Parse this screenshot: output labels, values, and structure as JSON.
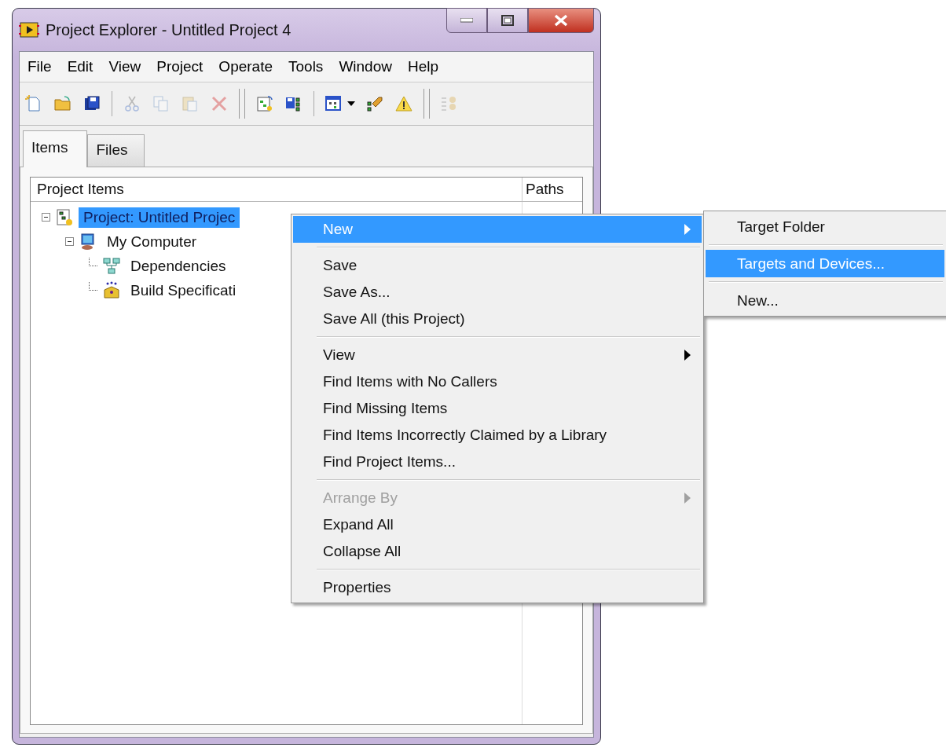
{
  "window": {
    "title": "Project Explorer - Untitled Project 4"
  },
  "menu_bar": [
    "File",
    "Edit",
    "View",
    "Project",
    "Operate",
    "Tools",
    "Window",
    "Help"
  ],
  "toolbar": [
    {
      "kind": "new",
      "disabled": false
    },
    {
      "kind": "open",
      "disabled": false
    },
    {
      "kind": "save",
      "disabled": false
    },
    {
      "kind": "separator"
    },
    {
      "kind": "cut",
      "disabled": true
    },
    {
      "kind": "copy",
      "disabled": true
    },
    {
      "kind": "paste",
      "disabled": true
    },
    {
      "kind": "delete",
      "disabled": true
    },
    {
      "kind": "grip"
    },
    {
      "kind": "add-file",
      "disabled": false
    },
    {
      "kind": "save-project",
      "disabled": false
    },
    {
      "kind": "separator"
    },
    {
      "kind": "view",
      "disabled": false
    },
    {
      "kind": "dropdown",
      "disabled": false
    },
    {
      "kind": "arrow-item",
      "disabled": false
    },
    {
      "kind": "warning",
      "disabled": false
    },
    {
      "kind": "grip"
    },
    {
      "kind": "build",
      "disabled": true
    }
  ],
  "tabs": [
    {
      "label": "Items",
      "selected": true
    },
    {
      "label": "Files",
      "selected": false
    }
  ],
  "tree": {
    "columns": [
      "Project Items",
      "Paths"
    ],
    "items": [
      {
        "label": "Project: Untitled Projec",
        "kind": "project",
        "selected": true,
        "expanded": true,
        "children": [
          {
            "label": "My Computer",
            "kind": "computer",
            "selected": false,
            "expanded": true,
            "children": [
              {
                "label": "Dependencies",
                "kind": "dependencies",
                "selected": false
              },
              {
                "label": "Build Specificati",
                "kind": "build",
                "selected": false
              }
            ]
          }
        ]
      }
    ]
  },
  "context_menu": {
    "items": [
      {
        "kind": "item",
        "label": "New",
        "selected": true,
        "disabled": false,
        "submenu": true
      },
      {
        "kind": "separator"
      },
      {
        "kind": "item",
        "label": "Save",
        "selected": false,
        "disabled": false,
        "submenu": false
      },
      {
        "kind": "item",
        "label": "Save As...",
        "selected": false,
        "disabled": false,
        "submenu": false
      },
      {
        "kind": "item",
        "label": "Save All (this Project)",
        "selected": false,
        "disabled": false,
        "submenu": false
      },
      {
        "kind": "separator"
      },
      {
        "kind": "item",
        "label": "View",
        "selected": false,
        "disabled": false,
        "submenu": true
      },
      {
        "kind": "item",
        "label": "Find Items with No Callers",
        "selected": false,
        "disabled": false,
        "submenu": false
      },
      {
        "kind": "item",
        "label": "Find Missing Items",
        "selected": false,
        "disabled": false,
        "submenu": false
      },
      {
        "kind": "item",
        "label": "Find Items Incorrectly Claimed by a Library",
        "selected": false,
        "disabled": false,
        "submenu": false
      },
      {
        "kind": "item",
        "label": "Find Project Items...",
        "selected": false,
        "disabled": false,
        "submenu": false
      },
      {
        "kind": "separator"
      },
      {
        "kind": "item",
        "label": "Arrange By",
        "selected": false,
        "disabled": true,
        "submenu": true
      },
      {
        "kind": "item",
        "label": "Expand All",
        "selected": false,
        "disabled": false,
        "submenu": false
      },
      {
        "kind": "item",
        "label": "Collapse All",
        "selected": false,
        "disabled": false,
        "submenu": false
      },
      {
        "kind": "separator"
      },
      {
        "kind": "item",
        "label": "Properties",
        "selected": false,
        "disabled": false,
        "submenu": false
      }
    ]
  },
  "submenu": {
    "items": [
      {
        "kind": "item",
        "label": "Target Folder",
        "selected": false,
        "disabled": false,
        "submenu": false
      },
      {
        "kind": "separator"
      },
      {
        "kind": "item",
        "label": "Targets and Devices...",
        "selected": true,
        "disabled": false,
        "submenu": false
      },
      {
        "kind": "separator"
      },
      {
        "kind": "item",
        "label": "New...",
        "selected": false,
        "disabled": false,
        "submenu": false
      }
    ]
  }
}
